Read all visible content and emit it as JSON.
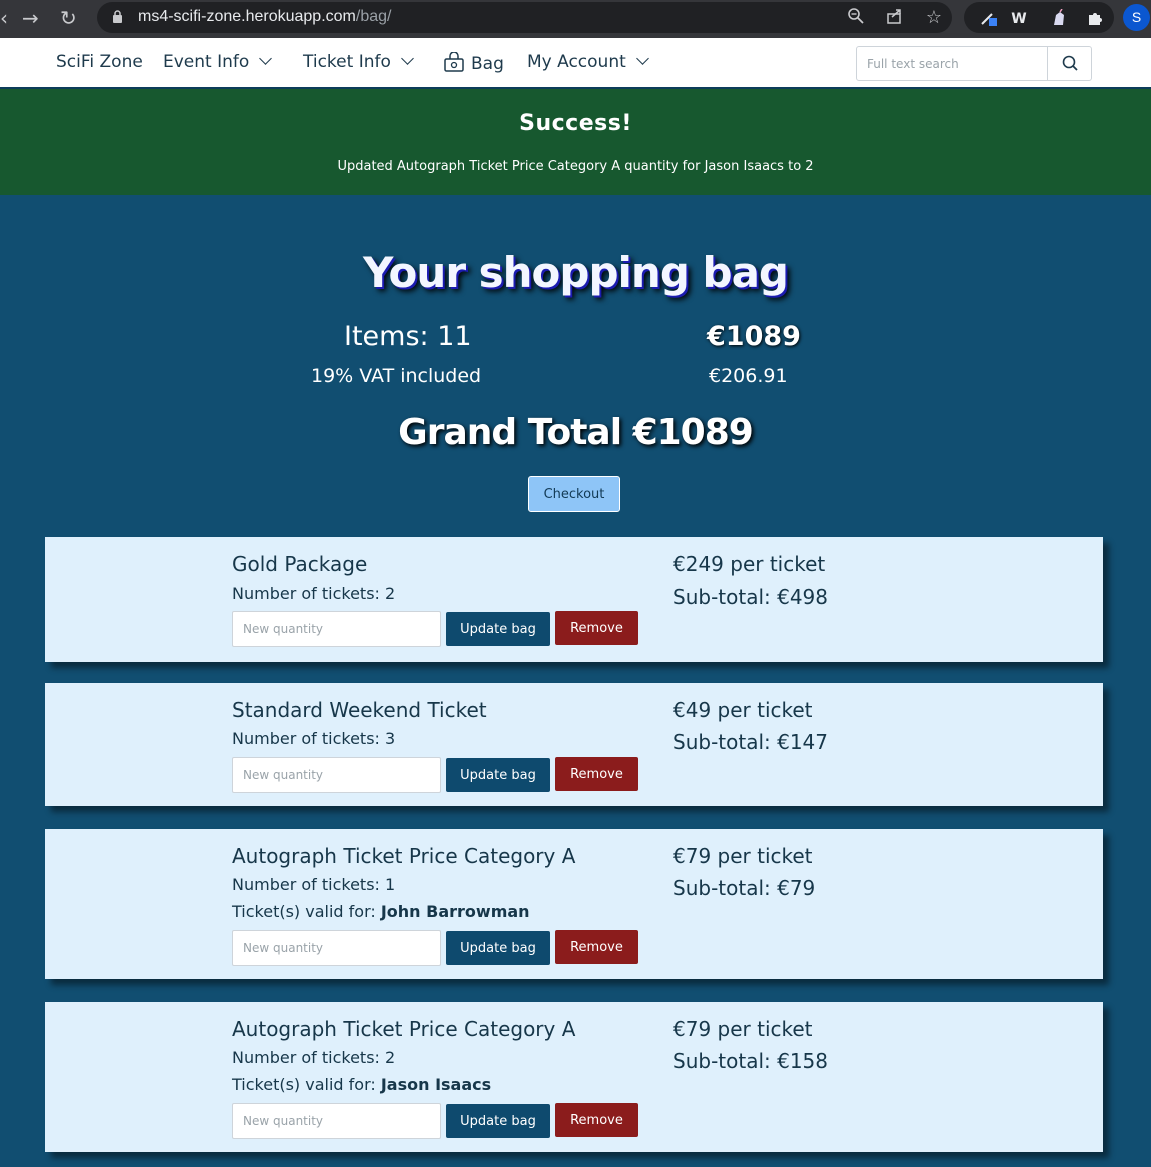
{
  "browser": {
    "url_host": "ms4-scifi-zone.herokuapp.com",
    "url_path": "/bag/",
    "profile_initial": "S"
  },
  "nav": {
    "brand": "SciFi Zone",
    "event_info": "Event Info",
    "ticket_info": "Ticket Info",
    "bag": "Bag",
    "my_account": "My Account",
    "search_placeholder": "Full text search"
  },
  "banner": {
    "title": "Success!",
    "message": "Updated Autograph Ticket Price Category A quantity for Jason Isaacs to 2"
  },
  "summary": {
    "title": "Your shopping bag",
    "items": "Items: 11",
    "total": "€1089",
    "vat_label": "19% VAT included",
    "vat_amount": "€206.91",
    "grand_total": "Grand Total €1089",
    "checkout": "Checkout"
  },
  "labels": {
    "qty_placeholder": "New quantity",
    "update": "Update bag",
    "remove": "Remove"
  },
  "items": [
    {
      "name": "Gold Package",
      "count": "Number of tickets: 2",
      "price": "€249 per ticket",
      "subtotal": "Sub-total: €498"
    },
    {
      "name": "Standard Weekend Ticket",
      "count": "Number of tickets: 3",
      "price": "€49 per ticket",
      "subtotal": "Sub-total: €147"
    },
    {
      "name": "Autograph Ticket Price Category A",
      "count": "Number of tickets: 1",
      "valid_label": "Ticket(s) valid for: ",
      "valid_for": "John Barrowman",
      "price": "€79 per ticket",
      "subtotal": "Sub-total: €79"
    },
    {
      "name": "Autograph Ticket Price Category A",
      "count": "Number of tickets: 2",
      "valid_label": "Ticket(s) valid for: ",
      "valid_for": "Jason Isaacs",
      "price": "€79 per ticket",
      "subtotal": "Sub-total: €158"
    }
  ]
}
